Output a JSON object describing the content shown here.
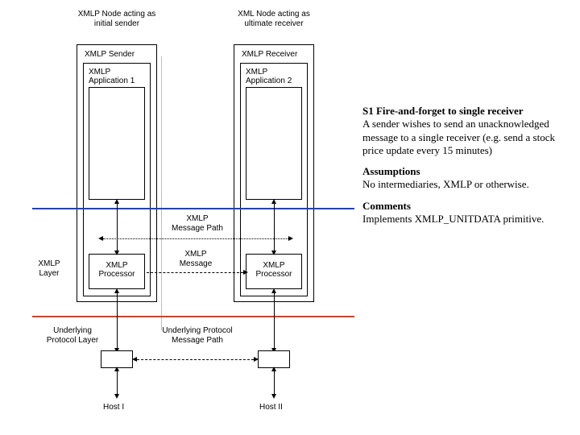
{
  "labels": {
    "sender_node": "XMLP Node acting as\ninitial sender",
    "receiver_node": "XML Node acting as\nultimate receiver",
    "sender_role": "XMLP Sender",
    "receiver_role": "XMLP Receiver",
    "app1": "XMLP\nApplication 1",
    "app2": "XMLP\nApplication 2",
    "msg_path": "XMLP\nMessage Path",
    "msg": "XMLP\nMessage",
    "proc": "XMLP\nProcessor",
    "xmlp_layer": "XMLP\nLayer",
    "und_proto_layer": "Underlying\nProtocol Layer",
    "und_proto_path": "Underlying Protocol\nMessage Path",
    "host1": "Host I",
    "host2": "Host II"
  },
  "text": {
    "title": "S1 Fire-and-forget to single receiver",
    "body": "A sender wishes to send an unacknowledged message to a single receiver (e.g. send a stock price update every 15 minutes)",
    "assump_h": "Assumptions",
    "assump_b": "No intermediaries, XMLP or otherwise.",
    "comm_h": "Comments",
    "comm_b": "Implements XMLP_UNITDATA primitive."
  }
}
